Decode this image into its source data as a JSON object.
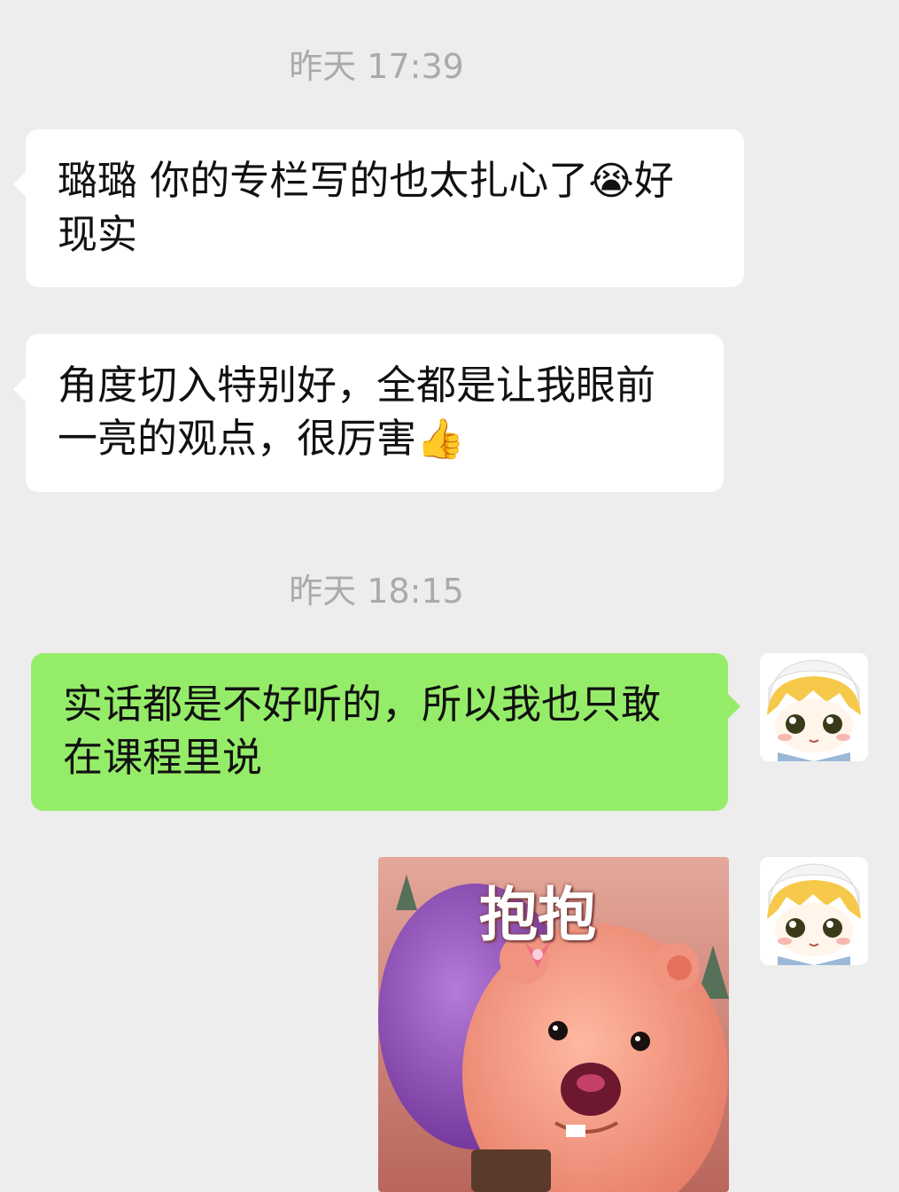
{
  "messages": [
    {
      "type": "timestamp",
      "text": "昨天 17:39"
    },
    {
      "type": "incoming",
      "text": "璐璐 你的专栏写的也太扎心了",
      "emoji": "😭",
      "text_after": "好现实"
    },
    {
      "type": "incoming",
      "text": "角度切入特别好，全都是让我眼前一亮的观点，很厉害",
      "emoji": "👍"
    },
    {
      "type": "timestamp",
      "text": "昨天 18:15"
    },
    {
      "type": "outgoing",
      "text": "实话都是不好听的，所以我也只敢在课程里说"
    },
    {
      "type": "outgoing_sticker",
      "caption": "抱抱"
    }
  ],
  "colors": {
    "background": "#ededed",
    "incoming_bubble": "#ffffff",
    "outgoing_bubble": "#95ec69",
    "timestamp_text": "#aaaaaa"
  },
  "icons": {
    "avatar": "anime-girl-avatar",
    "sticker": "pink-beaver-hug-sticker"
  }
}
